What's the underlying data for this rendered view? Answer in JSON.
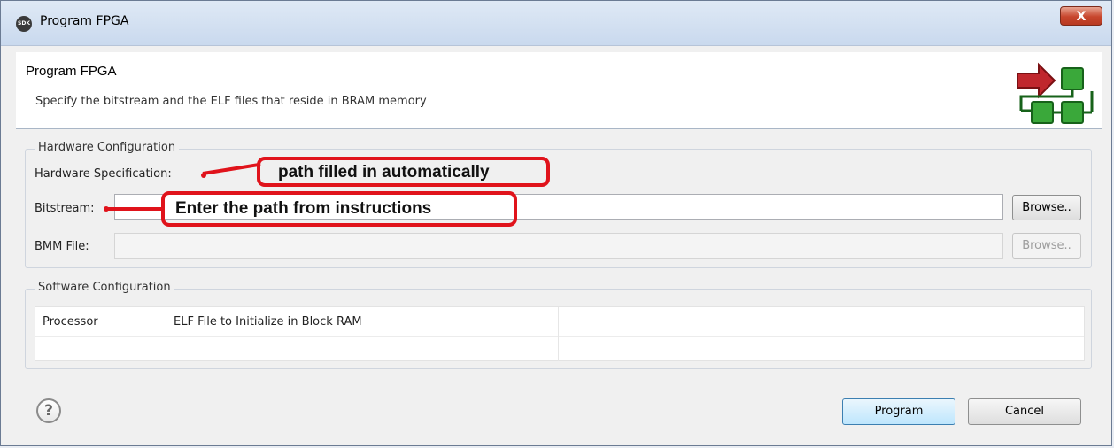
{
  "window": {
    "title": "Program FPGA",
    "app_icon_text": "SDK",
    "close_label": "X"
  },
  "header": {
    "title": "Program FPGA",
    "description": "Specify the bitstream and the ELF files that reside in BRAM memory",
    "logo_icon": "wizard-flow-icon"
  },
  "hardware": {
    "legend": "Hardware Configuration",
    "spec_label": "Hardware Specification:",
    "bitstream_label": "Bitstream:",
    "bitstream_value": "",
    "bitstream_browse": "Browse..",
    "bmm_label": "BMM File:",
    "bmm_value": "",
    "bmm_browse": "Browse.."
  },
  "software": {
    "legend": "Software Configuration",
    "columns": [
      "Processor",
      "ELF File to Initialize in Block RAM",
      ""
    ]
  },
  "footer": {
    "help_glyph": "?",
    "program_label": "Program",
    "cancel_label": "Cancel"
  },
  "annotations": {
    "spec_note": "path filled in automatically",
    "bitstream_note": "Enter the path from instructions"
  },
  "colors": {
    "annotation": "#e0131b",
    "logo_arrow": "#c0272d",
    "logo_box": "#3aa83a"
  }
}
